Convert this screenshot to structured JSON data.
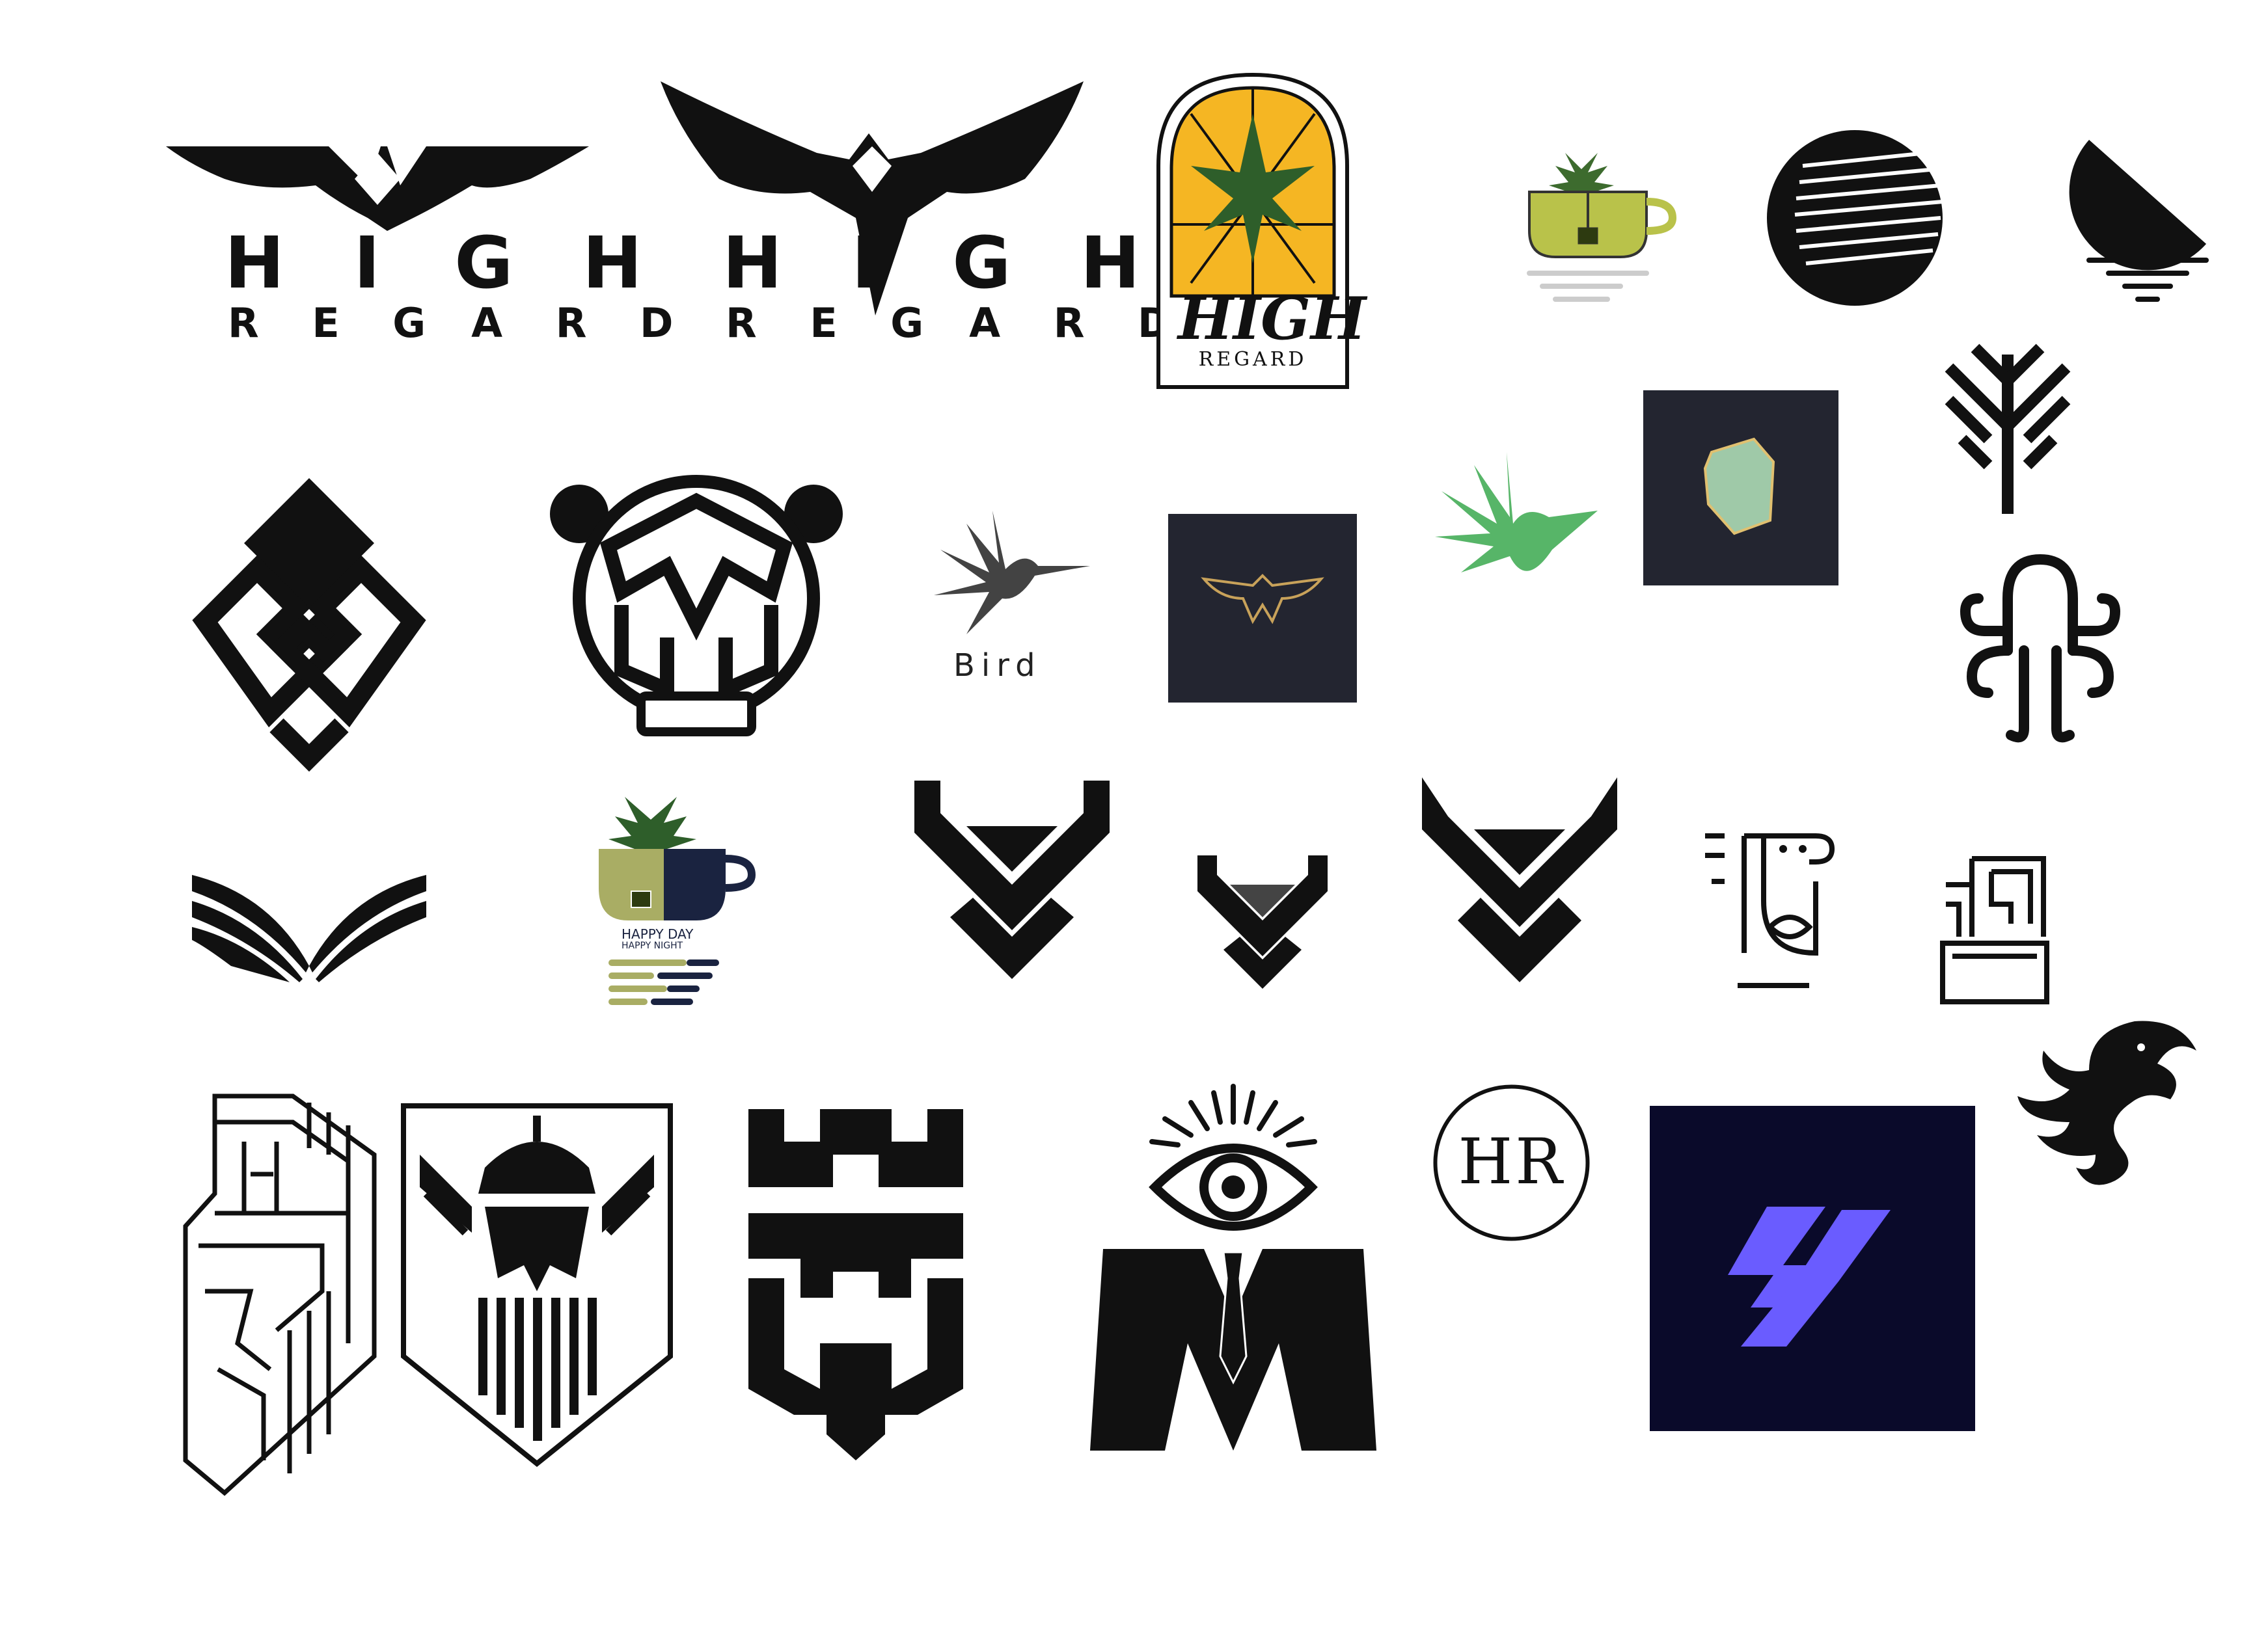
{
  "logos": {
    "high_regard_1": {
      "line1": "H I",
      "line1b": "G H",
      "line2": "R E G",
      "line2b": "A R D"
    },
    "high_regard_2": {
      "line1": "H I",
      "line1b": "G H",
      "line2": "R E G",
      "line2b": "A R D"
    },
    "high_regard_badge": {
      "line1": "HIGH",
      "line2": "REGARD"
    },
    "bird": {
      "label": "Bird"
    },
    "teacup_happy": {
      "line1": "HAPPY DAY",
      "line2": "HAPPY NIGHT"
    },
    "hr_circle": {
      "label": "HR"
    }
  },
  "colors": {
    "ink": "#111111",
    "amber": "#f5b623",
    "leaf_green": "#2e5e2a",
    "olive": "#a8b53a",
    "dark_tile": "#232530",
    "navy_tile": "#0a0a2a",
    "gold": "#c8a25a",
    "violet": "#6a5cff",
    "hummingbird_green": "#3aa84e"
  }
}
